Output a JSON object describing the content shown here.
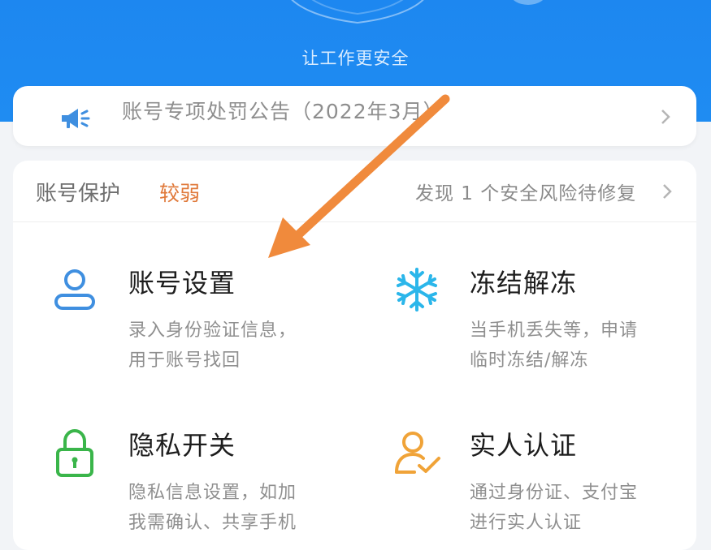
{
  "header": {
    "slogan": "让工作更安全"
  },
  "notice": {
    "icon": "megaphone-icon",
    "text": "账号专项处罚公告（2022年3月）"
  },
  "protection": {
    "label": "账号保护",
    "level": "较弱",
    "risk_text": "发现 1 个安全风险待修复"
  },
  "features": [
    {
      "icon": "user-icon",
      "title": "账号设置",
      "desc_line1": "录入身份验证信息，",
      "desc_line2": "用于账号找回"
    },
    {
      "icon": "snowflake-icon",
      "title": "冻结解冻",
      "desc_line1": "当手机丢失等，申请",
      "desc_line2": "临时冻结/解冻"
    },
    {
      "icon": "lock-icon",
      "title": "隐私开关",
      "desc_line1": "隐私信息设置，如加",
      "desc_line2": "我需确认、共享手机"
    },
    {
      "icon": "user-check-icon",
      "title": "实人认证",
      "desc_line1": "通过身份证、支付宝",
      "desc_line2": "进行实人认证"
    }
  ],
  "colors": {
    "header_blue": "#1f8cf2",
    "accent_orange": "#e0793a",
    "arrow_orange": "#f08a3c",
    "icon_blue": "#3f8fe0",
    "icon_cyan": "#2bb6ea",
    "icon_green": "#3ab54a",
    "icon_orange": "#f0a338"
  }
}
